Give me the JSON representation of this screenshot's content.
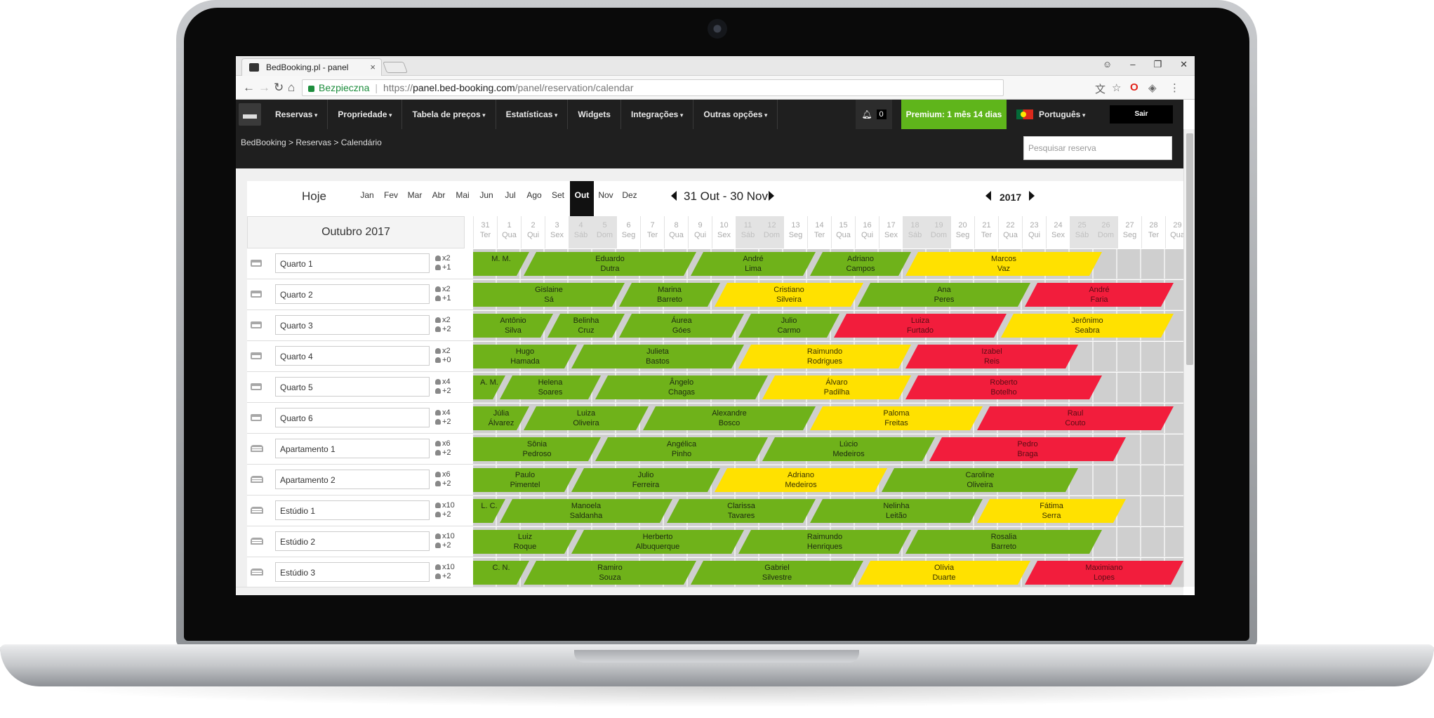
{
  "browser": {
    "tab_title": "BedBooking.pl - panel",
    "tab_close": "×",
    "security_label": "Bezpieczna",
    "url_scheme": "https://",
    "url_host": "panel.bed-booking.com",
    "url_path": "/panel/reservation/calendar",
    "win_profile": "☺",
    "win_minimize": "–",
    "win_maximize": "❐",
    "win_close": "✕"
  },
  "nav": {
    "items": [
      {
        "label": "Reservas",
        "arrow": true
      },
      {
        "label": "Propriedade",
        "arrow": true
      },
      {
        "label": "Tabela de preços",
        "arrow": true
      },
      {
        "label": "Estatísticas",
        "arrow": true
      },
      {
        "label": "Widgets",
        "arrow": false
      },
      {
        "label": "Integrações",
        "arrow": true
      },
      {
        "label": "Outras opções",
        "arrow": true
      }
    ],
    "notifications": "0",
    "premium": "Premium: 1 mês 14 dias",
    "language": "Português",
    "logout": "Sair"
  },
  "breadcrumb": "BedBooking > Reservas > Calendário",
  "search": {
    "placeholder": "Pesquisar reserva"
  },
  "calendar": {
    "today": "Hoje",
    "months": [
      "Jan",
      "Fev",
      "Mar",
      "Abr",
      "Mai",
      "Jun",
      "Jul",
      "Ago",
      "Set",
      "Out",
      "Nov",
      "Dez"
    ],
    "active_month_index": 9,
    "range": "31 Out - 30 Nov",
    "year": "2017",
    "month_label": "Outubro 2017",
    "days": [
      {
        "n": "31",
        "w": "Ter",
        "we": false
      },
      {
        "n": "1",
        "w": "Qua",
        "we": false
      },
      {
        "n": "2",
        "w": "Qui",
        "we": false
      },
      {
        "n": "3",
        "w": "Sex",
        "we": false
      },
      {
        "n": "4",
        "w": "Sáb",
        "we": true
      },
      {
        "n": "5",
        "w": "Dom",
        "we": true
      },
      {
        "n": "6",
        "w": "Seg",
        "we": false
      },
      {
        "n": "7",
        "w": "Ter",
        "we": false
      },
      {
        "n": "8",
        "w": "Qua",
        "we": false
      },
      {
        "n": "9",
        "w": "Qui",
        "we": false
      },
      {
        "n": "10",
        "w": "Sex",
        "we": false
      },
      {
        "n": "11",
        "w": "Sáb",
        "we": true
      },
      {
        "n": "12",
        "w": "Dom",
        "we": true
      },
      {
        "n": "13",
        "w": "Seg",
        "we": false
      },
      {
        "n": "14",
        "w": "Ter",
        "we": false
      },
      {
        "n": "15",
        "w": "Qua",
        "we": false
      },
      {
        "n": "16",
        "w": "Qui",
        "we": false
      },
      {
        "n": "17",
        "w": "Sex",
        "we": false
      },
      {
        "n": "18",
        "w": "Sáb",
        "we": true
      },
      {
        "n": "19",
        "w": "Dom",
        "we": true
      },
      {
        "n": "20",
        "w": "Seg",
        "we": false
      },
      {
        "n": "21",
        "w": "Ter",
        "we": false
      },
      {
        "n": "22",
        "w": "Qua",
        "we": false
      },
      {
        "n": "23",
        "w": "Qui",
        "we": false
      },
      {
        "n": "24",
        "w": "Sex",
        "we": false
      },
      {
        "n": "25",
        "w": "Sáb",
        "we": true
      },
      {
        "n": "26",
        "w": "Dom",
        "we": true
      },
      {
        "n": "27",
        "w": "Seg",
        "we": false
      },
      {
        "n": "28",
        "w": "Ter",
        "we": false
      },
      {
        "n": "29",
        "w": "Qua",
        "we": false
      }
    ],
    "status_colors": {
      "green": "#6fb21a",
      "yellow": "#ffe100",
      "red": "#f21d3c"
    },
    "rooms": [
      {
        "name": "Quarto 1",
        "icon": "bed",
        "cap": "x2",
        "extra": "+1",
        "res": [
          {
            "g": "M. M.",
            "s": 0,
            "e": 2,
            "c": "green"
          },
          {
            "g": "Eduardo\nDutra",
            "s": 2,
            "e": 9,
            "c": "green"
          },
          {
            "g": "André\nLima",
            "s": 9,
            "e": 14,
            "c": "green"
          },
          {
            "g": "Adriano\nCampos",
            "s": 14,
            "e": 18,
            "c": "green"
          },
          {
            "g": "Marcos\nVaz",
            "s": 18,
            "e": 26,
            "c": "yellow"
          }
        ]
      },
      {
        "name": "Quarto 2",
        "icon": "bed",
        "cap": "x2",
        "extra": "+1",
        "res": [
          {
            "g": "Gislaine\nSá",
            "s": 0,
            "e": 6,
            "c": "green"
          },
          {
            "g": "Marina\nBarreto",
            "s": 6,
            "e": 10,
            "c": "green"
          },
          {
            "g": "Cristiano\nSilveira",
            "s": 10,
            "e": 16,
            "c": "yellow"
          },
          {
            "g": "Ana\nPeres",
            "s": 16,
            "e": 23,
            "c": "green"
          },
          {
            "g": "André\nFaria",
            "s": 23,
            "e": 29,
            "c": "red"
          }
        ]
      },
      {
        "name": "Quarto 3",
        "icon": "bed",
        "cap": "x2",
        "extra": "+2",
        "res": [
          {
            "g": "Antônio\nSilva",
            "s": 0,
            "e": 3,
            "c": "green"
          },
          {
            "g": "Belinha\nCruz",
            "s": 3,
            "e": 6,
            "c": "green"
          },
          {
            "g": "Áurea\nGóes",
            "s": 6,
            "e": 11,
            "c": "green"
          },
          {
            "g": "Julio\nCarmo",
            "s": 11,
            "e": 15,
            "c": "green"
          },
          {
            "g": "Luiza\nFurtado",
            "s": 15,
            "e": 22,
            "c": "red"
          },
          {
            "g": "Jerônimo\nSeabra",
            "s": 22,
            "e": 29,
            "c": "yellow"
          }
        ]
      },
      {
        "name": "Quarto 4",
        "icon": "bed",
        "cap": "x2",
        "extra": "+0",
        "res": [
          {
            "g": "Hugo\nHamada",
            "s": 0,
            "e": 4,
            "c": "green"
          },
          {
            "g": "Julieta\nBastos",
            "s": 4,
            "e": 11,
            "c": "green"
          },
          {
            "g": "Raimundo\nRodrigues",
            "s": 11,
            "e": 18,
            "c": "yellow"
          },
          {
            "g": "Izabel\nReis",
            "s": 18,
            "e": 25,
            "c": "red"
          }
        ]
      },
      {
        "name": "Quarto 5",
        "icon": "bed",
        "cap": "x4",
        "extra": "+2",
        "res": [
          {
            "g": "A. M.",
            "s": 0,
            "e": 1,
            "c": "green"
          },
          {
            "g": "Helena\nSoares",
            "s": 1,
            "e": 5,
            "c": "green"
          },
          {
            "g": "Ângelo\nChagas",
            "s": 5,
            "e": 12,
            "c": "green"
          },
          {
            "g": "Álvaro\nPadilha",
            "s": 12,
            "e": 18,
            "c": "yellow"
          },
          {
            "g": "Roberto\nBotelho",
            "s": 18,
            "e": 26,
            "c": "red"
          }
        ]
      },
      {
        "name": "Quarto 6",
        "icon": "bed",
        "cap": "x4",
        "extra": "+2",
        "res": [
          {
            "g": "Júlia\nÁlvarez",
            "s": 0,
            "e": 2,
            "c": "green"
          },
          {
            "g": "Luiza\nOliveira",
            "s": 2,
            "e": 7,
            "c": "green"
          },
          {
            "g": "Alexandre\nBosco",
            "s": 7,
            "e": 14,
            "c": "green"
          },
          {
            "g": "Paloma\nFreitas",
            "s": 14,
            "e": 21,
            "c": "yellow"
          },
          {
            "g": "Raul\nCouto",
            "s": 21,
            "e": 29,
            "c": "red"
          }
        ]
      },
      {
        "name": "Apartamento 1",
        "icon": "sofa",
        "cap": "x6",
        "extra": "+2",
        "res": [
          {
            "g": "Sônia\nPedroso",
            "s": 0,
            "e": 5,
            "c": "green"
          },
          {
            "g": "Angélica\nPinho",
            "s": 5,
            "e": 12,
            "c": "green"
          },
          {
            "g": "Lúcio\nMedeiros",
            "s": 12,
            "e": 19,
            "c": "green"
          },
          {
            "g": "Pedro\nBraga",
            "s": 19,
            "e": 27,
            "c": "red"
          }
        ]
      },
      {
        "name": "Apartamento 2",
        "icon": "sofa",
        "cap": "x6",
        "extra": "+2",
        "res": [
          {
            "g": "Paulo\nPimentel",
            "s": 0,
            "e": 4,
            "c": "green"
          },
          {
            "g": "Julio\nFerreira",
            "s": 4,
            "e": 10,
            "c": "green"
          },
          {
            "g": "Adriano\nMedeiros",
            "s": 10,
            "e": 17,
            "c": "yellow"
          },
          {
            "g": "Caroline\nOliveira",
            "s": 17,
            "e": 25,
            "c": "green"
          }
        ]
      },
      {
        "name": "Estúdio 1",
        "icon": "sofa",
        "cap": "x10",
        "extra": "+2",
        "res": [
          {
            "g": "L. C.",
            "s": 0,
            "e": 1,
            "c": "green"
          },
          {
            "g": "Manoela\nSaldanha",
            "s": 1,
            "e": 8,
            "c": "green"
          },
          {
            "g": "Clarissa\nTavares",
            "s": 8,
            "e": 14,
            "c": "green"
          },
          {
            "g": "Nelinha\nLeitão",
            "s": 14,
            "e": 21,
            "c": "green"
          },
          {
            "g": "Fátima\nSerra",
            "s": 21,
            "e": 27,
            "c": "yellow"
          }
        ]
      },
      {
        "name": "Estúdio 2",
        "icon": "sofa",
        "cap": "x10",
        "extra": "+2",
        "res": [
          {
            "g": "Luiz\nRoque",
            "s": 0,
            "e": 4,
            "c": "green"
          },
          {
            "g": "Herberto\nAlbuquerque",
            "s": 4,
            "e": 11,
            "c": "green"
          },
          {
            "g": "Raimundo\nHenriques",
            "s": 11,
            "e": 18,
            "c": "green"
          },
          {
            "g": "Rosalia\nBarreto",
            "s": 18,
            "e": 26,
            "c": "green"
          }
        ]
      },
      {
        "name": "Estúdio 3",
        "icon": "sofa",
        "cap": "x10",
        "extra": "+2",
        "res": [
          {
            "g": "C. N.",
            "s": 0,
            "e": 2,
            "c": "green"
          },
          {
            "g": "Ramiro\nSouza",
            "s": 2,
            "e": 9,
            "c": "green"
          },
          {
            "g": "Gabriel\nSilvestre",
            "s": 9,
            "e": 16,
            "c": "green"
          },
          {
            "g": "Olívia\nDuarte",
            "s": 16,
            "e": 23,
            "c": "yellow"
          },
          {
            "g": "Maximiano\nLopes",
            "s": 23,
            "e": 31,
            "c": "red"
          }
        ]
      }
    ]
  }
}
